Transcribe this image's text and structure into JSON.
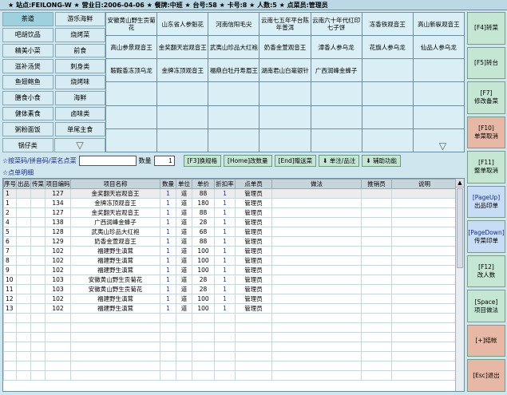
{
  "status_bar": "★ 站点:FEILONG-W ★ 营业日:2006-04-06 ★ 餐牌:中班 ★ 台号:58 ★ 卡号:8 ★ 人数:5 ★ 点菜员:管理员",
  "categories": [
    "茶道",
    "游乐海鲜",
    "吧胡饮品",
    "烧烤菜",
    "精美小菜",
    "前食",
    "滋补汤煲",
    "刺身类",
    "鱼翅鲍鱼",
    "烧烤味",
    "膳食小食",
    "海鲜",
    "健体素食",
    "卤味类",
    "粥粉面饭",
    "单尾主食",
    "锅仔类"
  ],
  "selected_category": "茶道",
  "dishes": [
    "安徽黄山野生贡菊花",
    "山东省人参魁花",
    "河南信阳毛尖",
    "云南七五年平台陈年普洱",
    "云南六十年代红印七子饼",
    "冻香铁观音王",
    "高山新枞观音王",
    "高山参景观音王",
    "金奖翻天岩观音王",
    "武夷山珍品大红袍",
    "奶香金萱观音王",
    "漳香人参乌龙",
    "花旗人参乌龙",
    "仙品人参乌龙",
    "鞍鞍香冻顶乌龙",
    "金牌冻顶观音王",
    "福鼎白牡丹寿眉王",
    "湖南君山白毫银针",
    "广西润峰金蜂子",
    "",
    "",
    "",
    "",
    "",
    "",
    "",
    "",
    "",
    "",
    "",
    "",
    "",
    "",
    "",
    "",
    "",
    "",
    "",
    "",
    "",
    "",
    "",
    "",
    "",
    "",
    "",
    "",
    ""
  ],
  "search": {
    "label": "☆按菜码/拼音码/菜名点菜",
    "value": "",
    "qty_label": "数量",
    "qty_value": "1",
    "buttons": [
      "[F3]换规格",
      "[Home]改数量",
      "[End]赠送菜",
      "⬇ 单注/品注",
      "⬇ 辅助功能"
    ]
  },
  "detail_title": "☆点单明细",
  "table": {
    "headers": [
      "序号",
      "出品",
      "传菜",
      "项目编码",
      "项目名称",
      "数量",
      "单位",
      "单价",
      "折扣率",
      "点单员",
      "做法",
      "推销员",
      "说明"
    ],
    "rows": [
      [
        "1",
        "",
        "",
        "127",
        "金奖翻天岩观音王",
        "1",
        "道",
        "88",
        "1",
        "管理员",
        "",
        "",
        ""
      ],
      [
        "1",
        "",
        "",
        "134",
        "金牌冻顶观音王",
        "1",
        "道",
        "180",
        "1",
        "管理员",
        "",
        "",
        ""
      ],
      [
        "2",
        "",
        "",
        "127",
        "金奖翻天岩观音王",
        "1",
        "道",
        "88",
        "1",
        "管理员",
        "",
        "",
        ""
      ],
      [
        "4",
        "",
        "",
        "138",
        "广西润峰金蜂子",
        "1",
        "道",
        "28",
        "1",
        "管理员",
        "",
        "",
        ""
      ],
      [
        "5",
        "",
        "",
        "128",
        "武夷山珍品大红袍",
        "1",
        "道",
        "68",
        "1",
        "管理员",
        "",
        "",
        ""
      ],
      [
        "6",
        "",
        "",
        "129",
        "奶香金萱观音王",
        "1",
        "道",
        "88",
        "1",
        "管理员",
        "",
        "",
        ""
      ],
      [
        "7",
        "",
        "",
        "102",
        "福建野生滇茸",
        "1",
        "道",
        "100",
        "1",
        "管理员",
        "",
        "",
        ""
      ],
      [
        "8",
        "",
        "",
        "102",
        "福建野生滇茸",
        "1",
        "道",
        "100",
        "1",
        "管理员",
        "",
        "",
        ""
      ],
      [
        "9",
        "",
        "",
        "102",
        "福建野生滇茸",
        "1",
        "道",
        "100",
        "1",
        "管理员",
        "",
        "",
        ""
      ],
      [
        "10",
        "",
        "",
        "103",
        "安徽黄山野生贡菊花",
        "1",
        "道",
        "28",
        "1",
        "管理员",
        "",
        "",
        ""
      ],
      [
        "11",
        "",
        "",
        "103",
        "安徽黄山野生贡菊花",
        "1",
        "道",
        "28",
        "1",
        "管理员",
        "",
        "",
        ""
      ],
      [
        "12",
        "",
        "",
        "102",
        "福建野生滇茸",
        "1",
        "道",
        "100",
        "1",
        "管理员",
        "",
        "",
        ""
      ],
      [
        "13",
        "",
        "",
        "102",
        "福建野生滇茸",
        "1",
        "道",
        "100",
        "1",
        "管理员",
        "",
        "",
        ""
      ]
    ]
  },
  "right_buttons": [
    {
      "key": "[F4]转菜",
      "label": "",
      "color": "green"
    },
    {
      "key": "[F5]转台",
      "label": "",
      "color": "green"
    },
    {
      "key": "[F7]",
      "label": "修改备菜",
      "color": "green"
    },
    {
      "key": "[F10]",
      "label": "单菜取消",
      "color": "red"
    },
    {
      "key": "[F11]",
      "label": "整单取消",
      "color": "green"
    },
    {
      "key": "[PageUp]",
      "label": "出品印单",
      "color": "blue"
    },
    {
      "key": "[PageDown]",
      "label": "传菜印单",
      "color": "blue"
    },
    {
      "key": "[F12]",
      "label": "改人数",
      "color": "green"
    },
    {
      "key": "[Space]",
      "label": "项目做法",
      "color": "green"
    },
    {
      "key": "[+]结帐",
      "label": "",
      "color": "red"
    },
    {
      "key": "[Esc]退出",
      "label": "",
      "color": "red"
    }
  ]
}
